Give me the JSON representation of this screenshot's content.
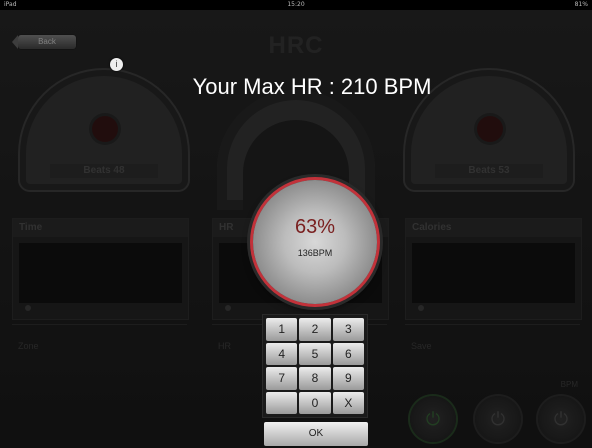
{
  "status_bar": {
    "carrier": "iPad",
    "time": "15:20",
    "battery": "81%"
  },
  "header": {
    "back_label": "Back",
    "title": "HRC"
  },
  "gauges": {
    "left": {
      "label": "Beats 48"
    },
    "right": {
      "label": "Beats 53"
    }
  },
  "panels": {
    "time": {
      "title": "Time"
    },
    "hr": {
      "title": "HR"
    },
    "calories": {
      "title": "Calories"
    }
  },
  "rows": {
    "left": "Zone",
    "mid": "HR",
    "right": "Save",
    "bottom_label": "BPM"
  },
  "popup": {
    "max_hr_text": "Your Max HR : 210 BPM",
    "info_icon": "info-icon",
    "dial_percent": "63%",
    "dial_bpm": "136BPM",
    "dial_ring_color": "#c2323a",
    "keypad_keys": [
      "1",
      "2",
      "3",
      "4",
      "5",
      "6",
      "7",
      "8",
      "9",
      "",
      "0",
      "X"
    ],
    "ok_label": "OK"
  }
}
